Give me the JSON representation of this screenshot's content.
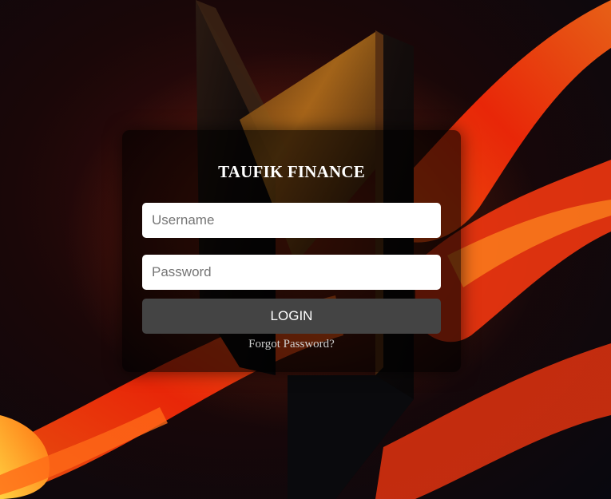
{
  "brand": {
    "title": "TAUFIK FINANCE"
  },
  "login_form": {
    "username_placeholder": "Username",
    "password_placeholder": "Password",
    "login_label": "LOGIN",
    "forgot_label": "Forgot Password?"
  },
  "colors": {
    "background": "#0b0810",
    "flame_primary": "#ff3a10",
    "flame_highlight": "#ffb000",
    "card_background": "rgba(0,0,0,0.62)",
    "button_background": "#444444",
    "title_text": "#ffffff"
  }
}
